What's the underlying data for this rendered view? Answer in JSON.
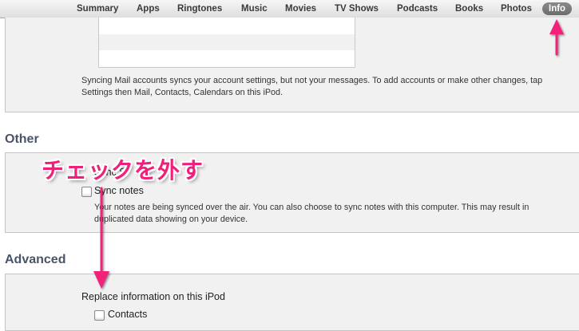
{
  "tabs": [
    {
      "label": "Summary"
    },
    {
      "label": "Apps"
    },
    {
      "label": "Ringtones"
    },
    {
      "label": "Music"
    },
    {
      "label": "Movies"
    },
    {
      "label": "TV Shows"
    },
    {
      "label": "Podcasts"
    },
    {
      "label": "Books"
    },
    {
      "label": "Photos"
    },
    {
      "label": "Info",
      "active": true
    }
  ],
  "mail": {
    "description": "Syncing Mail accounts syncs your account settings, but not your messages. To add accounts or make other changes, tap Settings then Mail, Contacts, Calendars on this iPod."
  },
  "other": {
    "title": "Other",
    "sync_partial_label": "Sync S",
    "sync_notes_label": "Sync notes",
    "sync_notes_checked": false,
    "notes_description": "Your notes are being synced over the air. You can also choose to sync notes with this computer. This may result in duplicated data showing on your device."
  },
  "advanced": {
    "title": "Advanced",
    "replace_label": "Replace information on this iPod",
    "contacts_label": "Contacts",
    "contacts_checked": false
  },
  "annotation": {
    "text": "チェックを外す",
    "color": "#f0207a"
  }
}
